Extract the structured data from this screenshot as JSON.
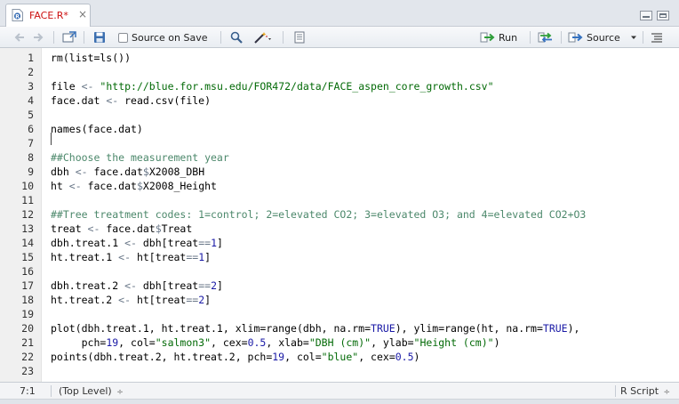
{
  "tab": {
    "title": "FACE.R*",
    "close": "×"
  },
  "toolbar": {
    "source_on_save_label": "Source on Save",
    "run_label": "Run",
    "source_label": "Source"
  },
  "lines": [
    {
      "n": "1",
      "tokens": [
        {
          "t": "rm(list=ls())"
        }
      ]
    },
    {
      "n": "2",
      "tokens": []
    },
    {
      "n": "3",
      "tokens": [
        {
          "t": "file "
        },
        {
          "t": "<-",
          "c": "t-op"
        },
        {
          "t": " "
        },
        {
          "t": "\"http://blue.for.msu.edu/FOR472/data/FACE_aspen_core_growth.csv\"",
          "c": "t-str"
        }
      ]
    },
    {
      "n": "4",
      "tokens": [
        {
          "t": "face.dat "
        },
        {
          "t": "<-",
          "c": "t-op"
        },
        {
          "t": " read.csv(file)"
        }
      ]
    },
    {
      "n": "5",
      "tokens": []
    },
    {
      "n": "6",
      "tokens": [
        {
          "t": "names(face.dat)"
        }
      ]
    },
    {
      "n": "7",
      "tokens": []
    },
    {
      "n": "8",
      "tokens": [
        {
          "t": "##Choose the measurement year",
          "c": "t-cmt"
        }
      ]
    },
    {
      "n": "9",
      "tokens": [
        {
          "t": "dbh "
        },
        {
          "t": "<-",
          "c": "t-op"
        },
        {
          "t": " face.dat"
        },
        {
          "t": "$",
          "c": "t-op"
        },
        {
          "t": "X2008_DBH"
        }
      ]
    },
    {
      "n": "10",
      "tokens": [
        {
          "t": "ht "
        },
        {
          "t": "<-",
          "c": "t-op"
        },
        {
          "t": " face.dat"
        },
        {
          "t": "$",
          "c": "t-op"
        },
        {
          "t": "X2008_Height"
        }
      ]
    },
    {
      "n": "11",
      "tokens": []
    },
    {
      "n": "12",
      "tokens": [
        {
          "t": "##Tree treatment codes: 1=control; 2=elevated CO2; 3=elevated O3; and 4=elevated CO2+O3",
          "c": "t-cmt"
        }
      ]
    },
    {
      "n": "13",
      "tokens": [
        {
          "t": "treat "
        },
        {
          "t": "<-",
          "c": "t-op"
        },
        {
          "t": " face.dat"
        },
        {
          "t": "$",
          "c": "t-op"
        },
        {
          "t": "Treat"
        }
      ]
    },
    {
      "n": "14",
      "tokens": [
        {
          "t": "dbh.treat.1 "
        },
        {
          "t": "<-",
          "c": "t-op"
        },
        {
          "t": " dbh[treat"
        },
        {
          "t": "==",
          "c": "t-op"
        },
        {
          "t": "1",
          "c": "t-num"
        },
        {
          "t": "]"
        }
      ]
    },
    {
      "n": "15",
      "tokens": [
        {
          "t": "ht.treat.1 "
        },
        {
          "t": "<-",
          "c": "t-op"
        },
        {
          "t": " ht[treat"
        },
        {
          "t": "==",
          "c": "t-op"
        },
        {
          "t": "1",
          "c": "t-num"
        },
        {
          "t": "]"
        }
      ]
    },
    {
      "n": "16",
      "tokens": []
    },
    {
      "n": "17",
      "tokens": [
        {
          "t": "dbh.treat.2 "
        },
        {
          "t": "<-",
          "c": "t-op"
        },
        {
          "t": " dbh[treat"
        },
        {
          "t": "==",
          "c": "t-op"
        },
        {
          "t": "2",
          "c": "t-num"
        },
        {
          "t": "]"
        }
      ]
    },
    {
      "n": "18",
      "tokens": [
        {
          "t": "ht.treat.2 "
        },
        {
          "t": "<-",
          "c": "t-op"
        },
        {
          "t": " ht[treat"
        },
        {
          "t": "==",
          "c": "t-op"
        },
        {
          "t": "2",
          "c": "t-num"
        },
        {
          "t": "]"
        }
      ]
    },
    {
      "n": "19",
      "tokens": []
    },
    {
      "n": "20",
      "tokens": [
        {
          "t": "plot(dbh.treat.1, ht.treat.1, xlim=range(dbh, na.rm="
        },
        {
          "t": "TRUE",
          "c": "t-kw"
        },
        {
          "t": "), ylim=range(ht, na.rm="
        },
        {
          "t": "TRUE",
          "c": "t-kw"
        },
        {
          "t": "),"
        }
      ]
    },
    {
      "n": "21",
      "tokens": [
        {
          "t": "     pch="
        },
        {
          "t": "19",
          "c": "t-num"
        },
        {
          "t": ", col="
        },
        {
          "t": "\"salmon3\"",
          "c": "t-str"
        },
        {
          "t": ", cex="
        },
        {
          "t": "0.5",
          "c": "t-num"
        },
        {
          "t": ", xlab="
        },
        {
          "t": "\"DBH (cm)\"",
          "c": "t-str"
        },
        {
          "t": ", ylab="
        },
        {
          "t": "\"Height (cm)\"",
          "c": "t-str"
        },
        {
          "t": ")"
        }
      ]
    },
    {
      "n": "22",
      "tokens": [
        {
          "t": "points(dbh.treat.2, ht.treat.2, pch="
        },
        {
          "t": "19",
          "c": "t-num"
        },
        {
          "t": ", col="
        },
        {
          "t": "\"blue\"",
          "c": "t-str"
        },
        {
          "t": ", cex="
        },
        {
          "t": "0.5",
          "c": "t-num"
        },
        {
          "t": ")"
        }
      ]
    },
    {
      "n": "23",
      "tokens": []
    }
  ],
  "status": {
    "position": "7:1",
    "scope": "(Top Level)",
    "scope_arrow": "÷",
    "filetype": "R Script",
    "filetype_arrow": "÷"
  }
}
